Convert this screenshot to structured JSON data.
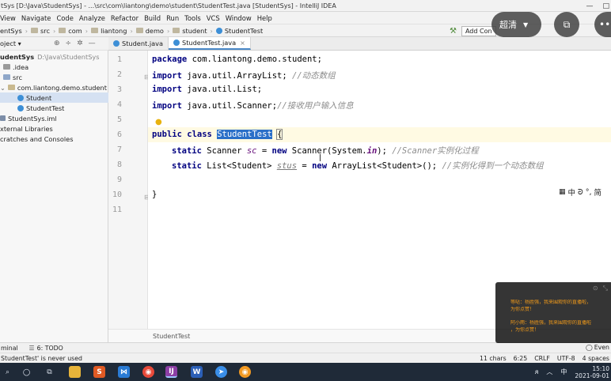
{
  "window": {
    "title": "tSys [D:\\Java\\StudentSys] - ...\\src\\com\\liantong\\demo\\student\\StudentTest.java [StudentSys] - IntelliJ IDEA",
    "controls": [
      "—",
      "□"
    ]
  },
  "menu": [
    "View",
    "Navigate",
    "Code",
    "Analyze",
    "Refactor",
    "Build",
    "Run",
    "Tools",
    "VCS",
    "Window",
    "Help"
  ],
  "nav": {
    "crumbs": [
      "entSys",
      "src",
      "com",
      "liantong",
      "demo",
      "student",
      "StudentTest"
    ],
    "add_config": "Add Con"
  },
  "project": {
    "header": "oject ▾",
    "tree": [
      {
        "label": "udentSys",
        "muted": "D:\\Java\\StudentSys",
        "indent": 0
      },
      {
        "label": ".idea",
        "indent": 1
      },
      {
        "label": "src",
        "indent": 1
      },
      {
        "label": "com.liantong.demo.student",
        "indent": 1
      },
      {
        "label": "Student",
        "indent": 3,
        "selected": true
      },
      {
        "label": "StudentTest",
        "indent": 3
      },
      {
        "label": "StudentSys.iml",
        "indent": 1
      },
      {
        "label": "xternal Libraries",
        "indent": 0
      },
      {
        "label": "cratches and Consoles",
        "indent": 0
      }
    ]
  },
  "tabs": [
    {
      "label": "Student.java",
      "active": false
    },
    {
      "label": "StudentTest.java",
      "active": true
    }
  ],
  "editor": {
    "line_numbers": [
      "1",
      "2",
      "3",
      "4",
      "5",
      "6",
      "7",
      "8",
      "9",
      "10",
      "11"
    ],
    "lines": [
      {
        "pkg_kw": "package",
        "pkg": "com.liantong.demo.student;"
      },
      {
        "kw": "import",
        "text": "java.util.ArrayList;",
        "comment": "//动态数组"
      },
      {
        "kw": "import",
        "text": "java.util.List;"
      },
      {
        "kw": "import",
        "text": "java.util.Scanner;",
        "comment": "//接收用户输入信息"
      },
      {
        "text": ""
      },
      {
        "kw1": "public",
        "kw2": "class",
        "name": "StudentTest",
        "rest": "{"
      },
      {
        "kw": "static",
        "type": "Scanner",
        "field": "sc",
        "eq": "=",
        "new": "new",
        "call": "Scanner(System.",
        "in": "in",
        "end": ");",
        "comment": "//Scanner实例化过程"
      },
      {
        "kw": "static",
        "type": "List<Student>",
        "field": "stus",
        "eq": "=",
        "new": "new",
        "call": "ArrayList<Student>();",
        "comment": "//实例化得到一个动态数组"
      },
      {
        "text": ""
      },
      {
        "text": "}"
      },
      {
        "text": ""
      }
    ],
    "crumb": "StudentTest"
  },
  "bottom_tools": [
    "minal",
    "6: TODO"
  ],
  "event_log": "Even",
  "status": {
    "message": "StudentTest' is never used",
    "chars": "11 chars",
    "position": "6:25",
    "line_sep": "CRLF",
    "encoding": "UTF-8",
    "indent": "4 spaces"
  },
  "taskbar": {
    "clock_time": "15:10",
    "clock_date": "2021-09-01",
    "ime": "中"
  },
  "overlay": {
    "pill_label": "超清",
    "ime_bar": [
      "中",
      "ᘐ",
      "°,",
      "简"
    ]
  },
  "chat": {
    "messages": [
      "等哒：杨胜强，我来围观你的直播啦，",
      "为你点赞！",
      "阿小雨：杨胜强，我来围观你的直播啦",
      "，为你点赞！"
    ]
  }
}
